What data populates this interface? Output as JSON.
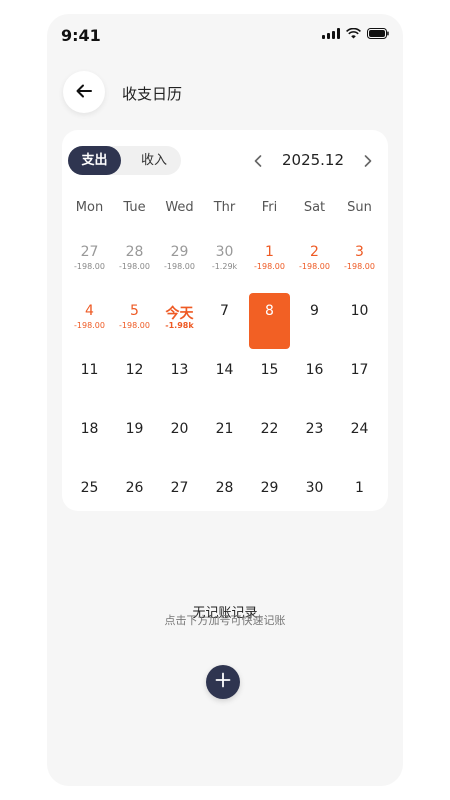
{
  "status_bar": {
    "time": "9:41"
  },
  "header": {
    "title": "收支日历"
  },
  "toggle": {
    "expense": "支出",
    "income": "收入"
  },
  "month_nav": {
    "label": "2025.12"
  },
  "weekdays": [
    "Mon",
    "Tue",
    "Wed",
    "Thr",
    "Fri",
    "Sat",
    "Sun"
  ],
  "calendar": {
    "weeks": [
      [
        {
          "label": "27",
          "amount": "-198.00",
          "type": "other"
        },
        {
          "label": "28",
          "amount": "-198.00",
          "type": "other"
        },
        {
          "label": "29",
          "amount": "-198.00",
          "type": "other"
        },
        {
          "label": "30",
          "amount": "-1.29k",
          "type": "other"
        },
        {
          "label": "1",
          "amount": "-198.00",
          "type": "red"
        },
        {
          "label": "2",
          "amount": "-198.00",
          "type": "red"
        },
        {
          "label": "3",
          "amount": "-198.00",
          "type": "red"
        }
      ],
      [
        {
          "label": "4",
          "amount": "-198.00",
          "type": "red"
        },
        {
          "label": "5",
          "amount": "-198.00",
          "type": "red"
        },
        {
          "label": "今天",
          "amount": "-1.98k",
          "type": "today"
        },
        {
          "label": "7",
          "amount": "",
          "type": "normal"
        },
        {
          "label": "8",
          "amount": "",
          "type": "selected"
        },
        {
          "label": "9",
          "amount": "",
          "type": "normal"
        },
        {
          "label": "10",
          "amount": "",
          "type": "normal"
        }
      ],
      [
        {
          "label": "11",
          "amount": "",
          "type": "normal"
        },
        {
          "label": "12",
          "amount": "",
          "type": "normal"
        },
        {
          "label": "13",
          "amount": "",
          "type": "normal"
        },
        {
          "label": "14",
          "amount": "",
          "type": "normal"
        },
        {
          "label": "15",
          "amount": "",
          "type": "normal"
        },
        {
          "label": "16",
          "amount": "",
          "type": "normal"
        },
        {
          "label": "17",
          "amount": "",
          "type": "normal"
        }
      ],
      [
        {
          "label": "18",
          "amount": "",
          "type": "normal"
        },
        {
          "label": "19",
          "amount": "",
          "type": "normal"
        },
        {
          "label": "20",
          "amount": "",
          "type": "normal"
        },
        {
          "label": "21",
          "amount": "",
          "type": "normal"
        },
        {
          "label": "22",
          "amount": "",
          "type": "normal"
        },
        {
          "label": "23",
          "amount": "",
          "type": "normal"
        },
        {
          "label": "24",
          "amount": "",
          "type": "normal"
        }
      ],
      [
        {
          "label": "25",
          "amount": "",
          "type": "normal"
        },
        {
          "label": "26",
          "amount": "",
          "type": "normal"
        },
        {
          "label": "27",
          "amount": "",
          "type": "normal"
        },
        {
          "label": "28",
          "amount": "",
          "type": "normal"
        },
        {
          "label": "29",
          "amount": "",
          "type": "normal"
        },
        {
          "label": "30",
          "amount": "",
          "type": "normal"
        },
        {
          "label": "1",
          "amount": "",
          "type": "normal"
        }
      ]
    ]
  },
  "empty_state": {
    "title": "无记账记录",
    "subtitle": "点击下方加号可快速记账"
  },
  "icons": {
    "back": "arrow-left-icon",
    "prev": "chevron-left-icon",
    "next": "chevron-right-icon",
    "add": "plus-icon",
    "signal": "signal-icon",
    "wifi": "wifi-icon",
    "battery": "battery-icon"
  },
  "colors": {
    "accent": "#f26024",
    "primary": "#2f3550",
    "highlight_text": "#ee5a24"
  }
}
